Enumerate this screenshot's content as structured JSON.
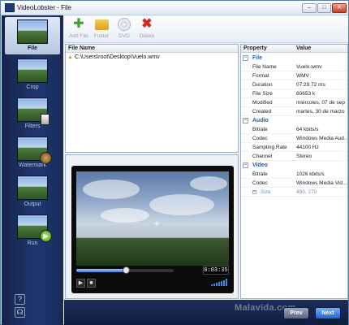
{
  "window": {
    "title": "VideoLobster - File"
  },
  "window_controls": {
    "minimize": "–",
    "maximize": "□",
    "close": "✕"
  },
  "sidebar": {
    "items": [
      {
        "label": "File",
        "icon": "film-icon"
      },
      {
        "label": "Crop",
        "icon": "crop-icon"
      },
      {
        "label": "Filters",
        "icon": "filter-icon"
      },
      {
        "label": "Watermark",
        "icon": "watermark-icon"
      },
      {
        "label": "Output",
        "icon": "output-icon"
      },
      {
        "label": "Run",
        "icon": "run-icon"
      }
    ],
    "help_icon": "?",
    "support_icon": "☊"
  },
  "toolbar": {
    "add_file": "Add File",
    "folder": "Folder",
    "dvd": "DVD",
    "delete": "Delete"
  },
  "files": {
    "header": "File Name",
    "rows": [
      "C:\\Users\\root\\Desktop\\Vuelo.wmv"
    ]
  },
  "player": {
    "time": "0:03:35",
    "progress": 0.5
  },
  "properties": {
    "header_property": "Property",
    "header_value": "Value",
    "file_label": "File",
    "file_rows": [
      {
        "k": "File Name",
        "v": "Vuelo.wmv"
      },
      {
        "k": "Format",
        "v": "WMV"
      },
      {
        "k": "Duration",
        "v": "07:29.72 ms"
      },
      {
        "k": "File Size",
        "v": "60653 k"
      },
      {
        "k": "Modified",
        "v": "miércoles, 07 de sep"
      },
      {
        "k": "Created",
        "v": "martes, 30 de marzo"
      }
    ],
    "audio_label": "Audio",
    "audio_rows": [
      {
        "k": "Bitrate",
        "v": "64 kbits/s"
      },
      {
        "k": "Codec",
        "v": "Windows Media Aud..."
      },
      {
        "k": "Sampling Rate",
        "v": "44100 Hz"
      },
      {
        "k": "Channel",
        "v": "Stereo"
      }
    ],
    "video_label": "Video",
    "video_rows": [
      {
        "k": "Bitrate",
        "v": "1026 kbits/s"
      },
      {
        "k": "Codec",
        "v": "Windows Media Vid..."
      }
    ],
    "size_row": {
      "k": "Size",
      "v": "480, 270"
    }
  },
  "footer": {
    "watermark": "Malavida.com",
    "prev": "Prev",
    "next": "Next"
  }
}
